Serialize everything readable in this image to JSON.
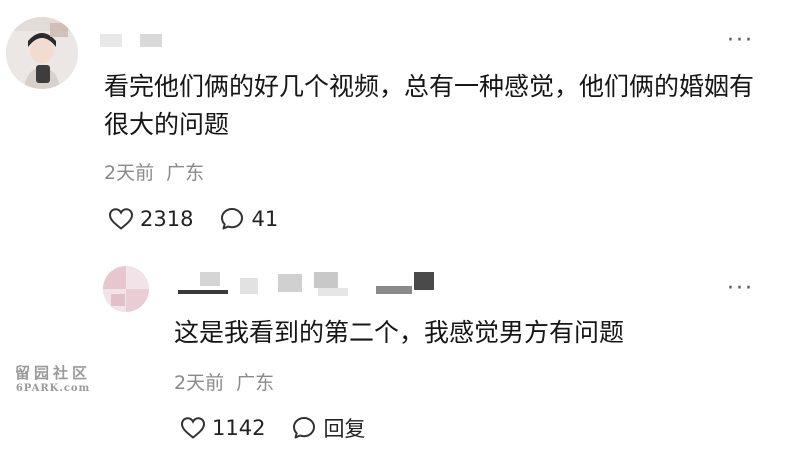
{
  "comments": [
    {
      "body": "看完他们俩的好几个视频，总有一种感觉，他们俩的婚姻有很大的问题",
      "time": "2天前",
      "location": "广东",
      "likes": "2318",
      "replies": "41"
    },
    {
      "body": "这是我看到的第二个，我感觉男方有问题",
      "time": "2天前",
      "location": "广东",
      "likes": "1142",
      "reply_label": "回复"
    }
  ],
  "more_glyph": "···",
  "watermark": {
    "cn": "留园社区",
    "en": "6PARK.com"
  },
  "colors": {
    "meta": "#8a8a8a",
    "text": "#161616",
    "icon": "#333333"
  },
  "icons": [
    "heart-icon",
    "comment-icon",
    "more-icon"
  ]
}
